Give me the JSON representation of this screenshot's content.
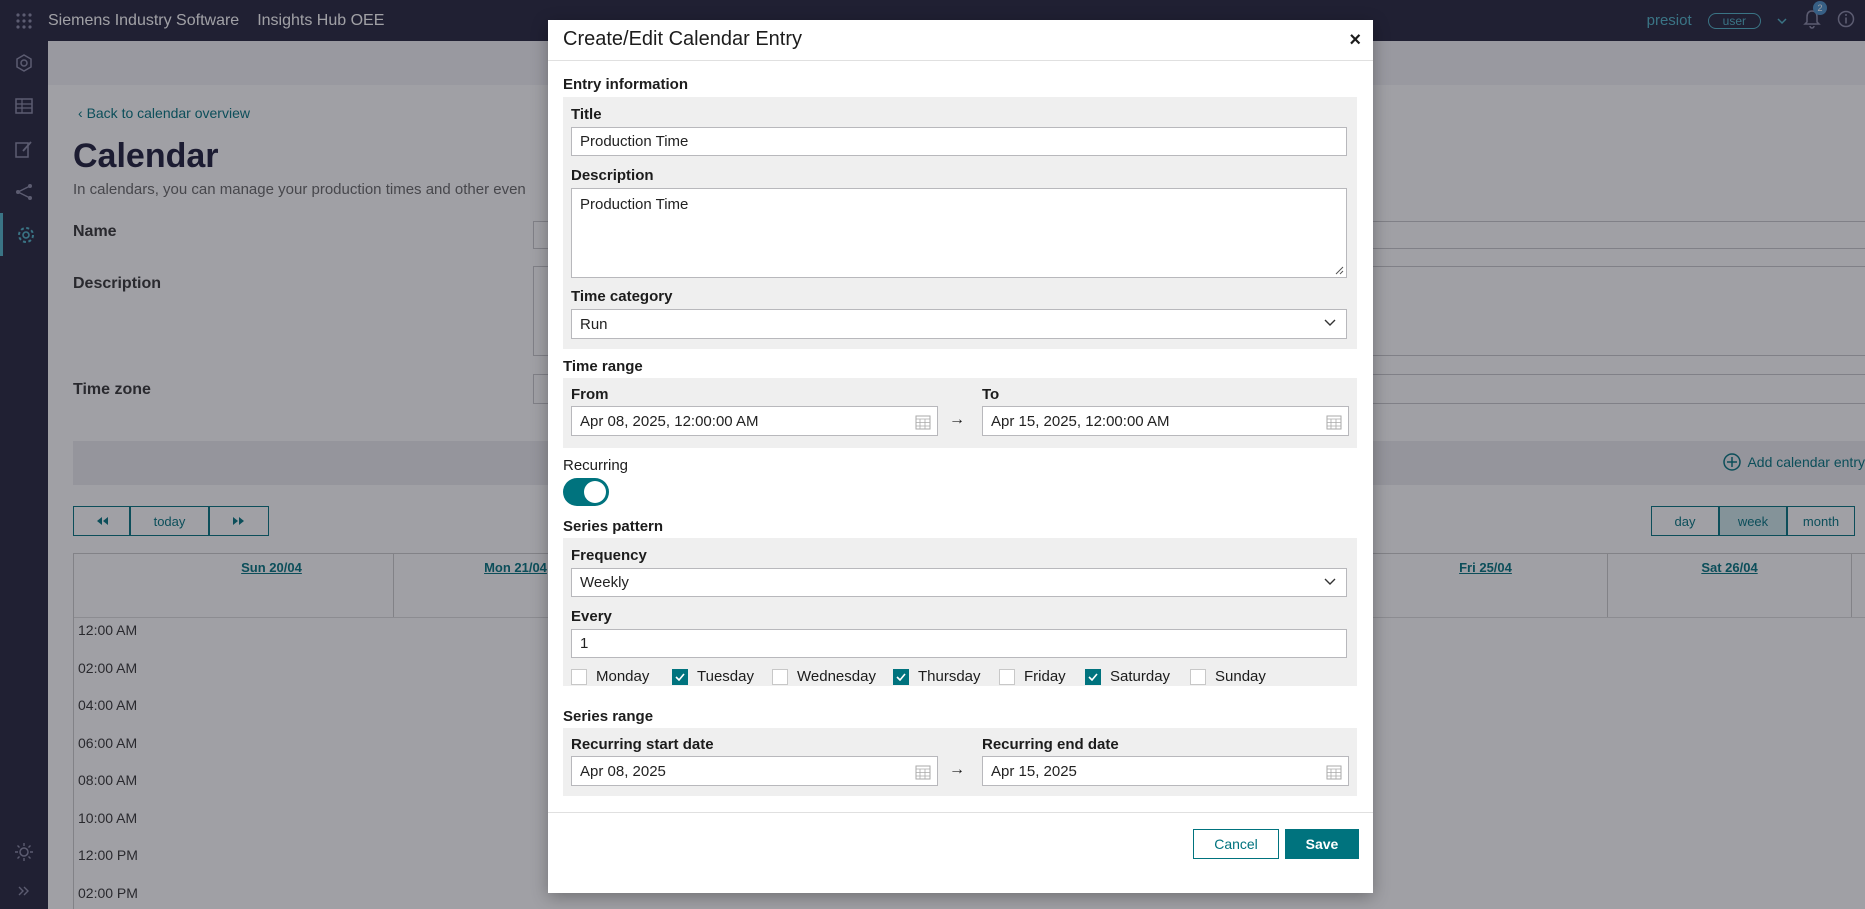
{
  "topbar": {
    "brand": "Siemens Industry Software",
    "app_name": "Insights Hub OEE",
    "user_name": "presiot",
    "user_role": "user",
    "notification_count": "2"
  },
  "rail": {
    "items": [
      "oee-icon",
      "table-icon",
      "edit-icon",
      "share-icon",
      "settings-icon"
    ],
    "bottom": [
      "theme-icon",
      "expand-icon"
    ]
  },
  "page": {
    "back_link": "Back to calendar overview",
    "title": "Calendar",
    "lead": "In calendars, you can manage your production times and other even",
    "name_label": "Name",
    "description_label": "Description",
    "timezone_label": "Time zone",
    "add_entry": "Add calendar entry",
    "nav": {
      "today": "today"
    },
    "views": {
      "day": "day",
      "week": "week",
      "month": "month"
    },
    "days": [
      "Sun 20/04",
      "Mon 21/04",
      "Fri 25/04",
      "Sat 26/04"
    ],
    "times": [
      "12:00 AM",
      "02:00 AM",
      "04:00 AM",
      "06:00 AM",
      "08:00 AM",
      "10:00 AM",
      "12:00 PM",
      "02:00 PM"
    ]
  },
  "modal": {
    "title": "Create/Edit Calendar Entry",
    "close": "×",
    "entry_info": {
      "section": "Entry information",
      "title_label": "Title",
      "title_value": "Production Time",
      "description_label": "Description",
      "description_value": "Production Time",
      "category_label": "Time category",
      "category_value": "Run"
    },
    "time_range": {
      "section": "Time range",
      "from_label": "From",
      "from_value": "Apr 08, 2025, 12:00:00 AM",
      "to_label": "To",
      "to_value": "Apr 15, 2025, 12:00:00 AM",
      "arrow": "→"
    },
    "recurring": {
      "label": "Recurring",
      "enabled": true
    },
    "series_pattern": {
      "section": "Series pattern",
      "frequency_label": "Frequency",
      "frequency_value": "Weekly",
      "every_label": "Every",
      "every_value": "1",
      "days": [
        {
          "label": "Monday",
          "checked": false
        },
        {
          "label": "Tuesday",
          "checked": true
        },
        {
          "label": "Wednesday",
          "checked": false
        },
        {
          "label": "Thursday",
          "checked": true
        },
        {
          "label": "Friday",
          "checked": false
        },
        {
          "label": "Saturday",
          "checked": true
        },
        {
          "label": "Sunday",
          "checked": false
        }
      ]
    },
    "series_range": {
      "section": "Series range",
      "start_label": "Recurring start date",
      "start_value": "Apr 08, 2025",
      "end_label": "Recurring end date",
      "end_value": "Apr 15, 2025",
      "arrow": "→"
    },
    "buttons": {
      "cancel": "Cancel",
      "save": "Save"
    }
  },
  "colors": {
    "accent": "#00737e",
    "topbar": "#23233c",
    "link": "#50b4c8"
  }
}
